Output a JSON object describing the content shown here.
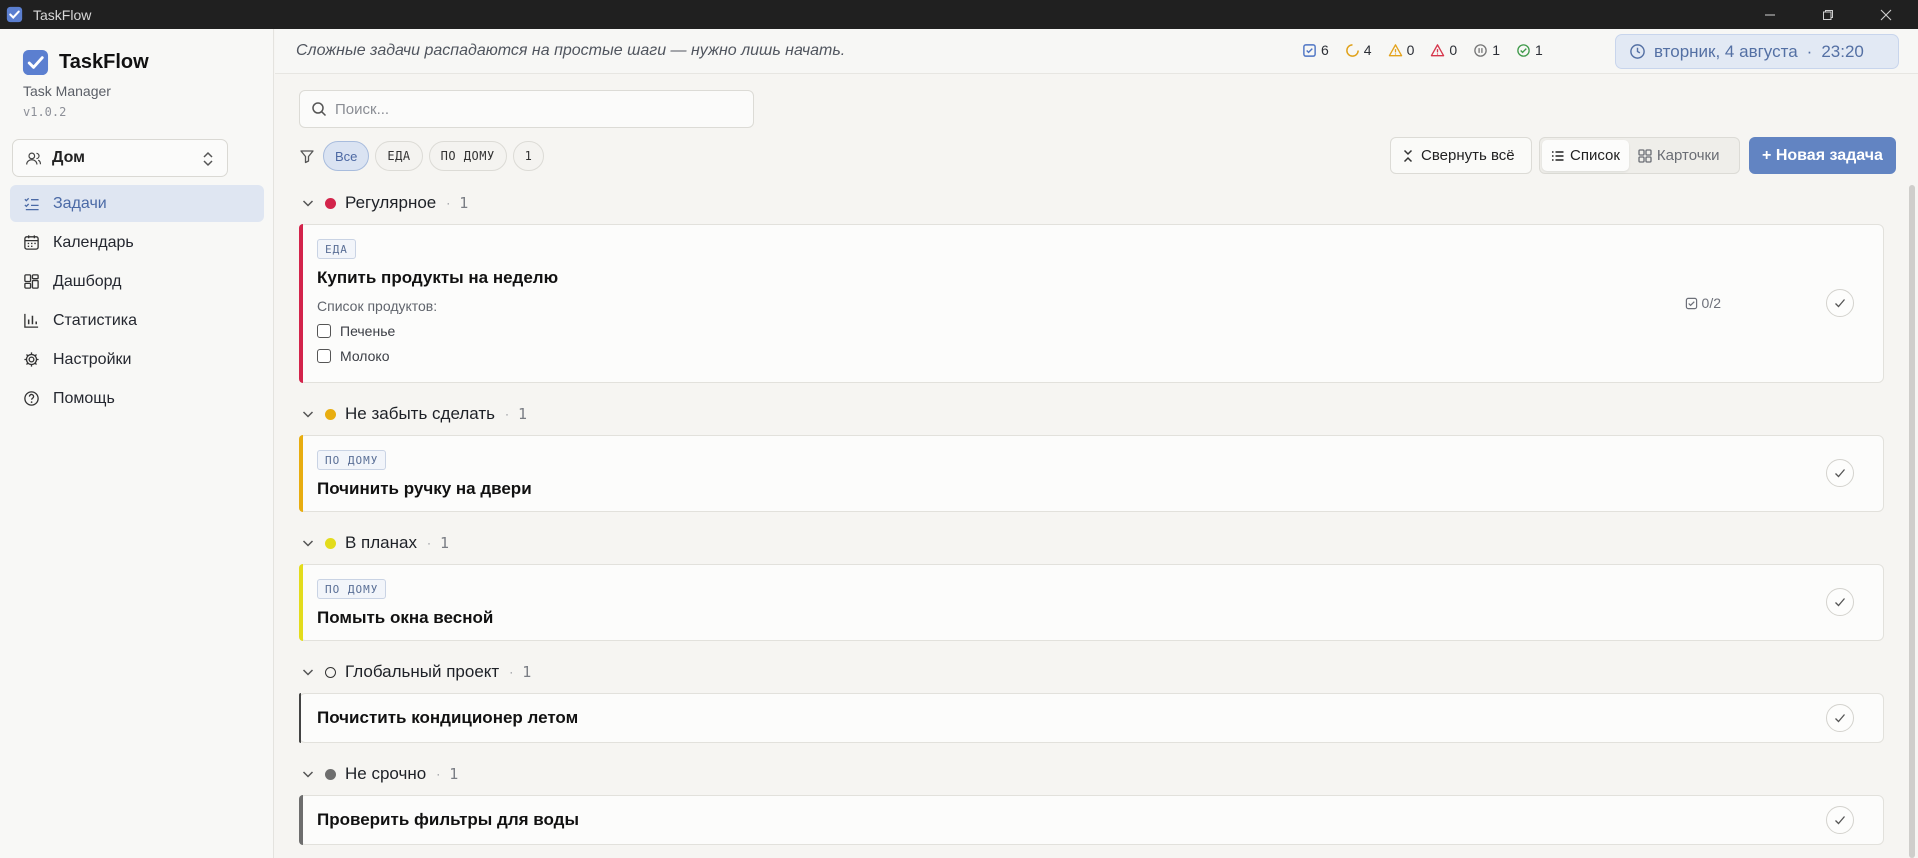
{
  "window": {
    "title": "TaskFlow"
  },
  "sidebar": {
    "brand": "TaskFlow",
    "subtitle": "Task Manager",
    "version": "v1.0.2",
    "workspace": "Дом",
    "items": [
      {
        "label": "Задачи",
        "icon": "checklist-icon",
        "active": true
      },
      {
        "label": "Календарь",
        "icon": "calendar-icon"
      },
      {
        "label": "Дашборд",
        "icon": "dashboard-icon"
      },
      {
        "label": "Статистика",
        "icon": "chart-icon"
      },
      {
        "label": "Настройки",
        "icon": "gear-icon"
      },
      {
        "label": "Помощь",
        "icon": "help-icon"
      }
    ]
  },
  "header": {
    "quote": "Сложные задачи распадаются на простые шаги — нужно лишь начать.",
    "stats": {
      "tasks": "6",
      "in_progress": "4",
      "warnings": "0",
      "overdue": "0",
      "paused": "1",
      "done": "1"
    },
    "date": "вторник, 4 августа",
    "separator": "·",
    "time": "23:20"
  },
  "toolbar": {
    "search_placeholder": "Поиск...",
    "filters": [
      "Все",
      "ЕДА",
      "ПО ДОМУ",
      "1"
    ],
    "collapse_label": "Свернуть всё",
    "view_list": "Список",
    "view_cards": "Карточки",
    "new_task": "+ Новая задача"
  },
  "groups": [
    {
      "name": "Регулярное",
      "count": "1",
      "color": "#d3244b",
      "task": {
        "tag": "ЕДА",
        "title": "Купить продукты на неделю",
        "subtitle": "Список продуктов:",
        "items": [
          "Печенье",
          "Молоко"
        ],
        "progress": "0/2"
      }
    },
    {
      "name": "Не забыть сделать",
      "count": "1",
      "color": "#e8ad10",
      "task": {
        "tag": "ПО ДОМУ",
        "title": "Починить ручку на двери"
      }
    },
    {
      "name": "В планах",
      "count": "1",
      "color": "#e3dc1c",
      "task": {
        "tag": "ПО ДОМУ",
        "title": "Помыть окна весной"
      }
    },
    {
      "name": "Глобальный проект",
      "count": "1",
      "color": "#444444",
      "task": {
        "title": "Почистить кондиционер летом"
      }
    },
    {
      "name": "Не срочно",
      "count": "1",
      "color": "#6e6e6e",
      "task": {
        "title": "Проверить фильтры для воды"
      }
    }
  ]
}
